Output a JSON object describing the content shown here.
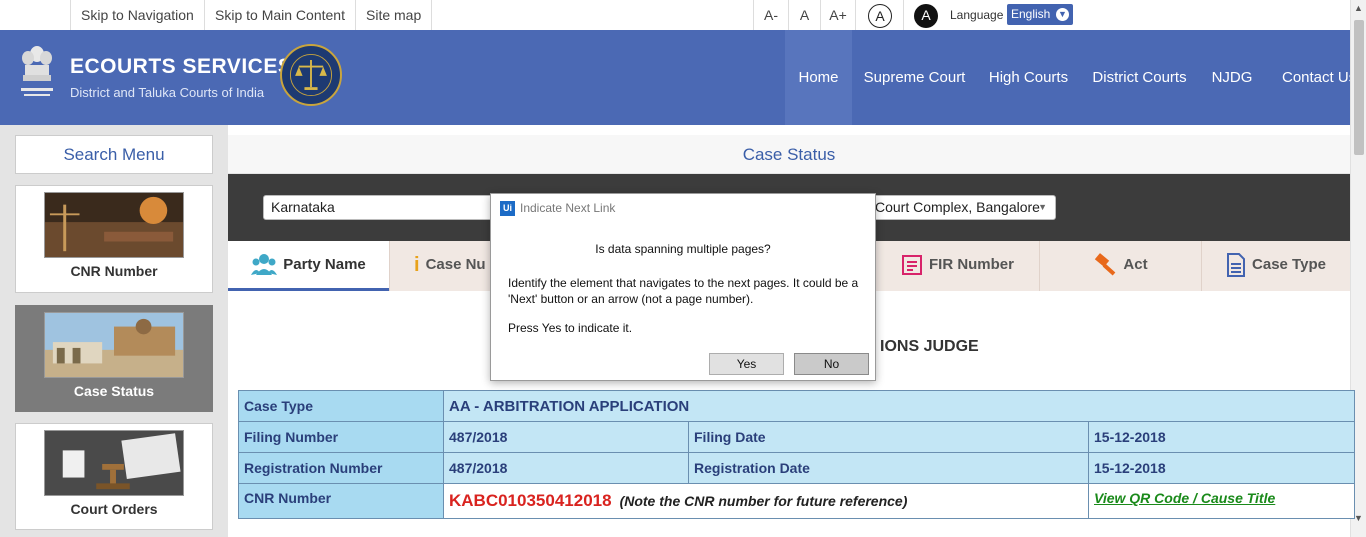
{
  "accessibility": {
    "skip_nav": "Skip to Navigation",
    "skip_main": "Skip to Main Content",
    "site_map": "Site map",
    "font_decrease": "A-",
    "font_normal": "A",
    "font_increase": "A+",
    "contrast_light": "A",
    "contrast_dark": "A",
    "language_label": "Language",
    "language_value": "English"
  },
  "header": {
    "title": "ECOURTS SERVICES",
    "subtitle": "District and Taluka Courts of India",
    "nav": [
      "Home",
      "Supreme Court",
      "High Courts",
      "District Courts",
      "NJDG",
      "Contact Us"
    ]
  },
  "sidebar": {
    "search_menu": "Search Menu",
    "cards": [
      "CNR Number",
      "Case Status",
      "Court Orders"
    ]
  },
  "main": {
    "title": "Case Status",
    "state_select": "Karnataka",
    "complex_select": "Court Complex, Bangalore",
    "tabs": [
      "Party Name",
      "Case Nu",
      "FIR Number",
      "Act",
      "Case Type"
    ],
    "court_heading": "IONS JUDGE"
  },
  "case_details": {
    "case_type_label": "Case Type",
    "case_type_value": "AA - ARBITRATION APPLICATION",
    "filing_number_label": "Filing Number",
    "filing_number_value": "487/2018",
    "filing_date_label": "Filing Date",
    "filing_date_value": "15-12-2018",
    "registration_number_label": "Registration Number",
    "registration_number_value": "487/2018",
    "registration_date_label": "Registration Date",
    "registration_date_value": "15-12-2018",
    "cnr_label": "CNR Number",
    "cnr_value": "KABC010350412018",
    "cnr_note": "(Note the CNR number for future reference)",
    "qr_link": "View QR Code / Cause Title"
  },
  "dialog": {
    "logo": "Ui",
    "title": "Indicate Next Link",
    "question": "Is data spanning multiple pages?",
    "body": "Identify the element that navigates to the next pages. It could be a 'Next' button or an arrow (not a page number).",
    "press": "Press Yes to indicate it.",
    "yes": "Yes",
    "no": "No"
  },
  "colors": {
    "header_blue": "#4b69b4",
    "table_label": "#a8daf1",
    "cnr_red": "#d9231f",
    "qr_green": "#1a8a1a"
  }
}
